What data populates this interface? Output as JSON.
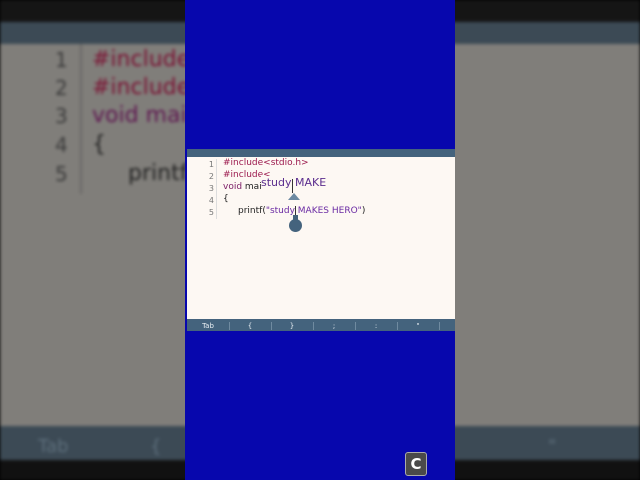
{
  "editor": {
    "line_numbers": [
      "1",
      "2",
      "3",
      "4",
      "5"
    ],
    "lines": {
      "l1": "#include<stdio.h>",
      "l2": "#include<",
      "l3_kw": "void",
      "l3_rest": " mai",
      "l4": "{",
      "l5_fn": "printf(",
      "l5_str": "\"study MAKES HERO\"",
      "l5_end": ")"
    },
    "magnifier_text": "study MAKE"
  },
  "keybar": {
    "keys": [
      "Tab",
      "{",
      "}",
      ";",
      ":",
      "\""
    ]
  },
  "background": {
    "line_numbers": [
      "1",
      "2",
      "3",
      "4",
      "5"
    ],
    "lines": [
      "#include",
      "#include",
      "void mai",
      "{",
      "printf"
    ],
    "keys": [
      "Tab",
      "{",
      "\""
    ]
  },
  "logo": {
    "letter": "C"
  },
  "colors": {
    "blue_panel": "#0707ad",
    "toolbar": "#44637d",
    "editor_bg": "#fdf8f3",
    "preprocessor": "#9c1a4e",
    "string": "#6a2aa3"
  }
}
